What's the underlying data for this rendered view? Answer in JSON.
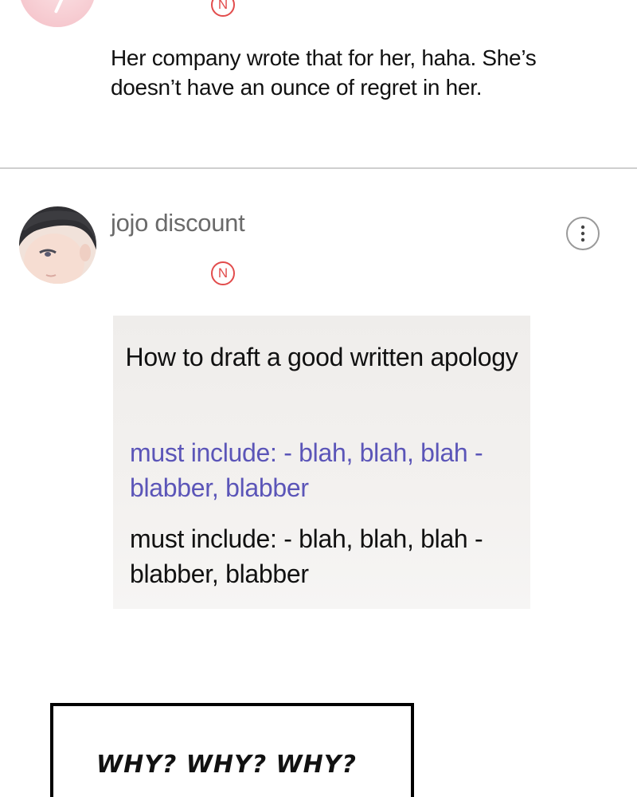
{
  "previous_comment": {
    "badge": "N",
    "text": "Her company wrote that for her, haha. She’s doesn’t have an ounce of regret in her."
  },
  "comment": {
    "username": "jojo discount",
    "badge": "N",
    "more_button_icon": "more-vertical-icon",
    "card": {
      "title": "How to draft a good written apology",
      "line_purple": "must include: - blah, blah, blah - blabber, blabber",
      "line_black": "must include: - blah, blah, blah - blabber, blabber"
    }
  },
  "speech_bubble": {
    "text": "WHY? WHY? WHY?"
  },
  "colors": {
    "badge_red": "#e24c4c",
    "purple_text": "#5b55b8",
    "divider": "#cfcfcf"
  }
}
